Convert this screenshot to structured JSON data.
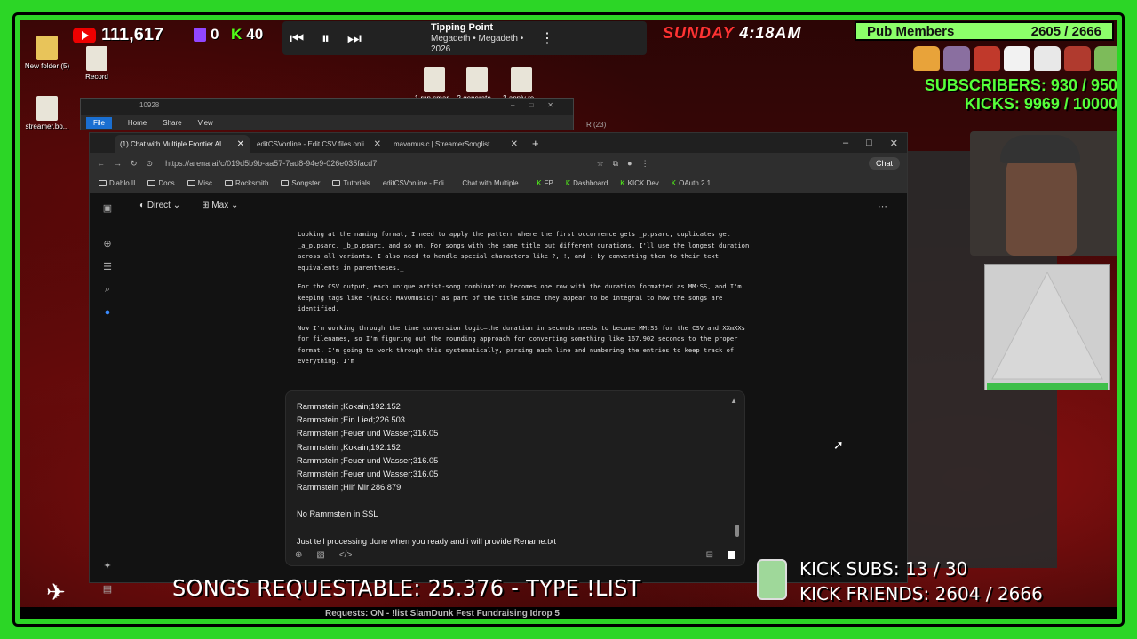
{
  "stream": {
    "yt_count": "111,617",
    "twitch_count": "0",
    "kick_count": "40",
    "now_playing_title": "Tipping Point",
    "now_playing_sub": "Megadeth • Megadeth • 2026",
    "day": "SUNDAY",
    "time": "4:18AM",
    "pub_members_label": "Pub Members",
    "pub_members_value": "2605 / 2666",
    "subscribers": "SUBSCRIBERS: 930 / 950",
    "kicks": "KICKS: 9969 / 10000",
    "songs_requestable": "SONGS REQUESTABLE: 25.376 - TYPE !LIST",
    "kick_subs": "KICK SUBS: 13 / 30",
    "kick_friends": "KICK FRIENDS: 2604 / 2666",
    "ticker": "Requests: ON - !list    SlamDunk Fest Fundraising    Idrop 5"
  },
  "desktop_icons": [
    {
      "label": "New folder (5)"
    },
    {
      "label": "Record"
    },
    {
      "label": "streamer.bo..."
    },
    {
      "label": "1 run smar..."
    },
    {
      "label": "2 generate..."
    },
    {
      "label": "3 apply re..."
    }
  ],
  "explorer": {
    "title": "10928",
    "tabs": [
      "File",
      "Home",
      "Share",
      "View"
    ],
    "second_title": "R (23)"
  },
  "browser": {
    "tabs": [
      {
        "label": "(1) Chat with Multiple Frontier AI"
      },
      {
        "label": "editCSVonline - Edit CSV files onli"
      },
      {
        "label": "mavomusic | StreamerSonglist"
      }
    ],
    "url": "https://arena.ai/c/019d5b9b-aa57-7ad8-94e9-026e035facd7",
    "chat_button": "Chat",
    "bookmarks": [
      "Diablo II",
      "Docs",
      "Misc",
      "Rocksmith",
      "Songster",
      "Tutorials",
      "editCSVonline - Edi...",
      "Chat with Multiple...",
      "FP",
      "Dashboard",
      "KICK Dev",
      "OAuth 2.1"
    ],
    "mode": "Direct",
    "model": "Max"
  },
  "thinking": [
    "Looking at the naming format, I need to apply the pattern where the first occurrence gets _p.psarc, duplicates get _a_p.psarc, _b_p.psarc, and so on. For songs with the same title but different durations, I'll use the longest duration across all variants. I also need to handle special characters like ?, !, and : by converting them to their text equivalents in parentheses._",
    "For the CSV output, each unique artist-song combination becomes one row with the duration formatted as MM:SS, and I'm keeping tags like \"(Kick: MAVOmusic)\" as part of the title since they appear to be integral to how the songs are identified.",
    "Now I'm working through the time conversion logic—the duration in seconds needs to become MM:SS for the CSV and XXmXXs for filenames, so I'm figuring out the rounding approach for converting something like 167.902 seconds to the proper format. I'm going to work through this systematically, parsing each line and numbering the entries to keep track of everything. I'm"
  ],
  "input_lines": [
    "Rammstein ;Kokain;192.152",
    "Rammstein ;Ein Lied;226.503",
    "Rammstein ;Feuer und Wasser;316.05",
    "Rammstein ;Kokain;192.152",
    "Rammstein ;Feuer und Wasser;316.05",
    "Rammstein ;Feuer und Wasser;316.05",
    "Rammstein ;Hilf Mir;286.879",
    "",
    "No Rammstein in SSL",
    "",
    "Just tell processing done when you ready and i will provide Rename.txt"
  ]
}
